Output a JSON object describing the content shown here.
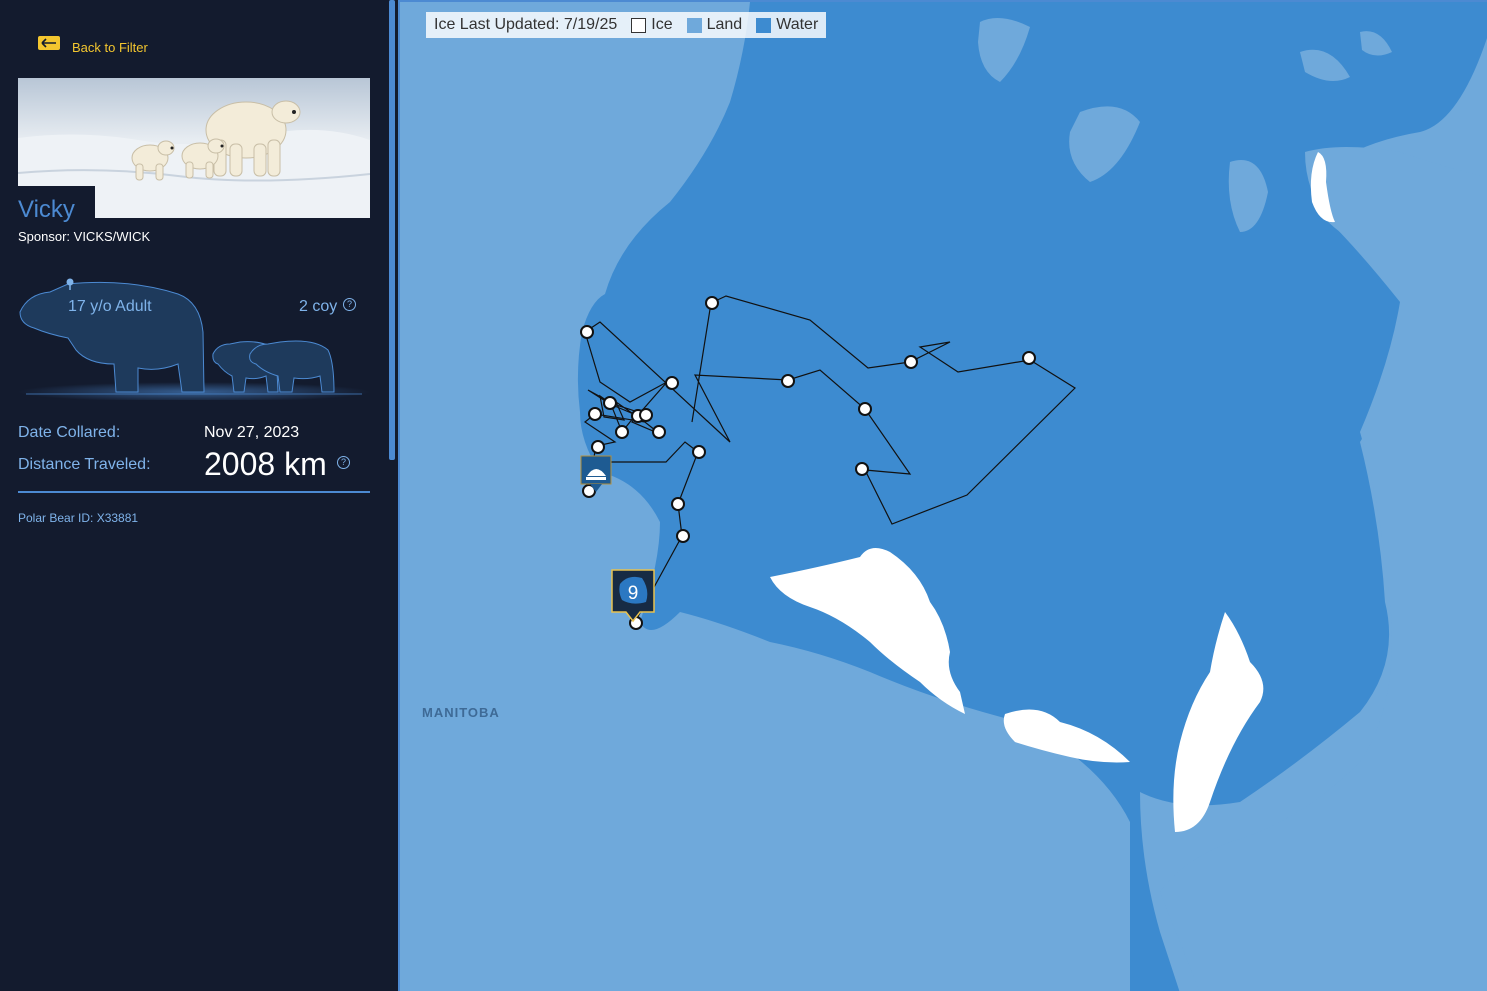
{
  "sidebar": {
    "back_label": "Back to Filter",
    "bear_name": "Vicky",
    "sponsor": "Sponsor: VICKS/WICK",
    "age": "17 y/o Adult",
    "coy": "2 coy",
    "help_glyph": "?",
    "date_collared_label": "Date Collared:",
    "date_collared_value": "Nov 27, 2023",
    "distance_label": "Distance Traveled:",
    "distance_value": "2008 km",
    "bear_id": "Polar Bear ID: X33881"
  },
  "map": {
    "legend": {
      "updated": "Ice Last Updated: 7/19/25",
      "ice": "Ice",
      "land": "Land",
      "water": "Water"
    },
    "colors": {
      "ice": "#ffffff",
      "land": "#6fa9db",
      "water": "#3d8bd0"
    },
    "region_label": "MANITOBA",
    "cluster_count": "9"
  },
  "icons": [
    "back-arrow-icon",
    "help-icon",
    "station-marker-icon",
    "cluster-bear-icon"
  ]
}
